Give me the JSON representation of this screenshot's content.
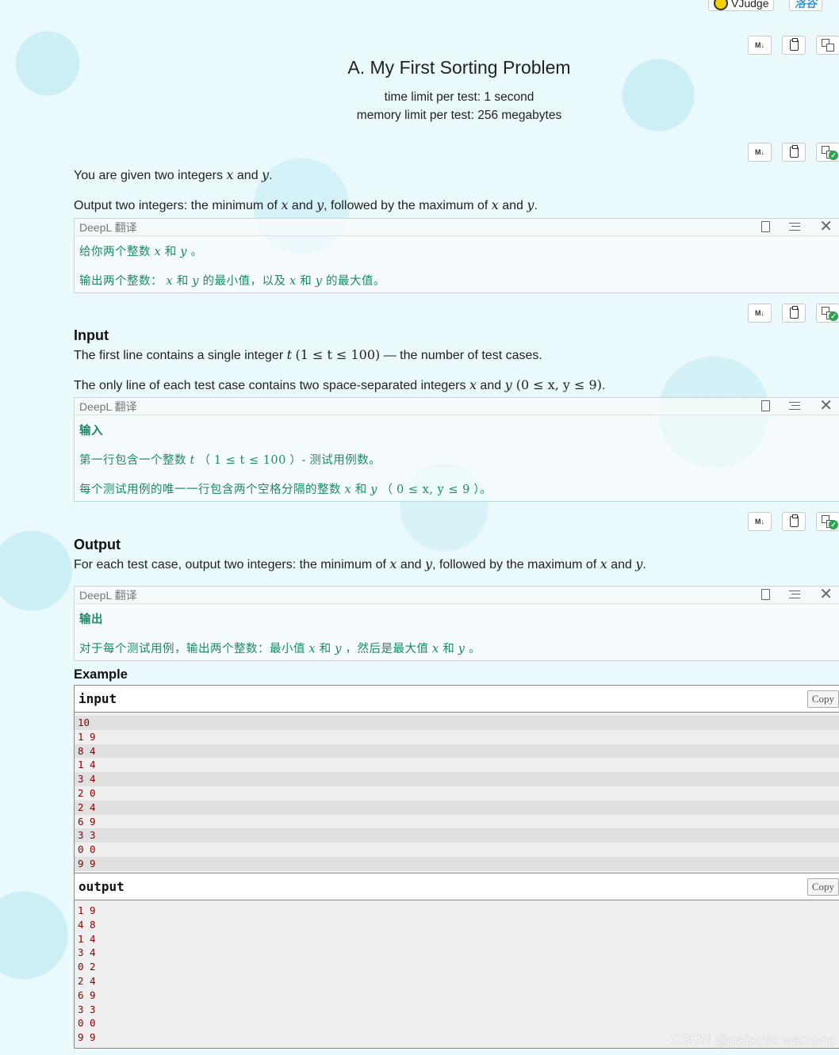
{
  "top_links": {
    "vjudge": "VJudge",
    "luogu": "洛谷"
  },
  "problem": {
    "title": "A. My First Sorting Problem",
    "time_limit": "time limit per test: 1 second",
    "memory_limit": "memory limit per test: 256 megabytes"
  },
  "toolbar": {
    "md_label": "M↓"
  },
  "statement": {
    "p1_a": "You are given two integers ",
    "p1_x": "x",
    "p1_b": " and ",
    "p1_y": "y",
    "p1_c": ".",
    "p2_a": "Output two integers: the minimum of ",
    "p2_x": "x",
    "p2_b": " and ",
    "p2_y": "y",
    "p2_c": ", followed by the maximum of ",
    "p2_x2": "x",
    "p2_d": " and ",
    "p2_y2": "y",
    "p2_e": "."
  },
  "deepl_label": "DeepL 翻译",
  "deepl1": {
    "l1_a": "给你两个整数 ",
    "l1_x": "x",
    "l1_b": " 和 ",
    "l1_y": "y",
    "l1_c": " 。",
    "l2_a": "输出两个整数： ",
    "l2_x": "x",
    "l2_b": " 和 ",
    "l2_y": "y",
    "l2_c": " 的最小值，以及 ",
    "l2_x2": "x",
    "l2_d": " 和 ",
    "l2_y2": "y",
    "l2_e": " 的最大值。"
  },
  "input_section": {
    "heading": "Input",
    "p1_a": "The first line contains a single integer ",
    "p1_t": "t",
    "p1_range": "(1 ≤ t ≤ 100)",
    "p1_b": " — the number of test cases.",
    "p2_a": "The only line of each test case contains two space-separated integers ",
    "p2_x": "x",
    "p2_b": " and ",
    "p2_y": "y",
    "p2_range": " (0 ≤ x, y ≤ 9)",
    "p2_c": "."
  },
  "deepl2": {
    "l1": "输入",
    "l2_a": "第一行包含一个整数 ",
    "l2_t": "t",
    "l2_b": " （ ",
    "l2_range": "1 ≤ t ≤ 100",
    "l2_c": " ）- 测试用例数。",
    "l3_a": "每个测试用例的唯一一行包含两个空格分隔的整数 ",
    "l3_x": "x",
    "l3_b": " 和 ",
    "l3_y": "y",
    "l3_c": " （ ",
    "l3_range": "0 ≤ x, y ≤ 9",
    "l3_d": " ）。"
  },
  "output_section": {
    "heading": "Output",
    "p1_a": "For each test case, output two integers: the minimum of ",
    "p1_x": "x",
    "p1_b": " and ",
    "p1_y": "y",
    "p1_c": ", followed by the maximum of ",
    "p1_x2": "x",
    "p1_d": " and ",
    "p1_y2": "y",
    "p1_e": "."
  },
  "deepl3": {
    "l1": "输出",
    "l2_a": "对于每个测试用例，输出两个整数：最小值 ",
    "l2_x": "x",
    "l2_b": " 和 ",
    "l2_y": "y",
    "l2_c": " ，然后是最大值 ",
    "l2_x2": "x",
    "l2_d": " 和 ",
    "l2_y2": "y",
    "l2_e": " 。"
  },
  "example": {
    "title": "Example",
    "input_label": "input",
    "output_label": "output",
    "copy_label": "Copy",
    "input_lines": [
      "10",
      "1 9",
      "8 4",
      "1 4",
      "3 4",
      "2 0",
      "2 4",
      "6 9",
      "3 3",
      "0 0",
      "9 9"
    ],
    "output_lines": [
      "1 9",
      "4 8",
      "1 4",
      "3 4",
      "0 2",
      "2 4",
      "6 9",
      "3 3",
      "0 0",
      "9 9"
    ]
  },
  "watermark": "CSDN @galactic warzone"
}
